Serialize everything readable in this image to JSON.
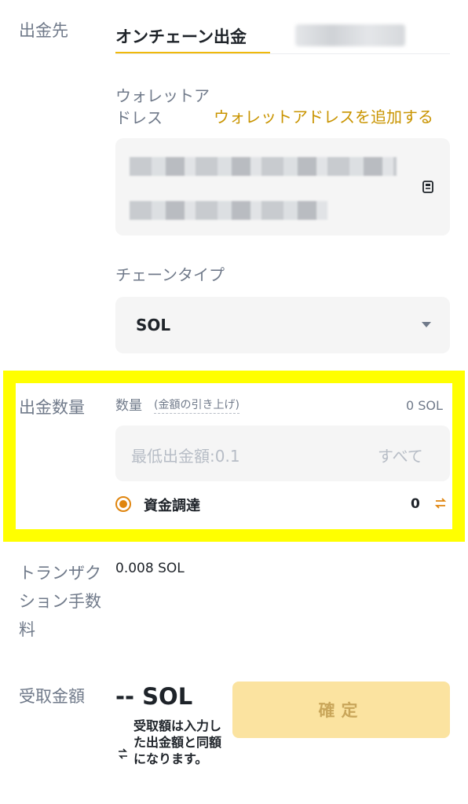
{
  "labels": {
    "destination": "出金先",
    "amount_section": "出金数量",
    "fee": "トランザクション手数料",
    "receive": "受取金額"
  },
  "tabs": {
    "onchain": "オンチェーン出金"
  },
  "wallet": {
    "label": "ウォレットアドレス",
    "add_link": "ウォレットアドレスを追加する"
  },
  "chain": {
    "label": "チェーンタイプ",
    "selected": "SOL"
  },
  "amount": {
    "label": "数量",
    "raise_link": "(金額の引き上げ)",
    "balance": "0 SOL",
    "placeholder": "最低出金額:0.1",
    "all_button": "すべて",
    "funding_label": "資金調達",
    "funding_value": "0"
  },
  "fee": {
    "value": "0.008 SOL"
  },
  "receive": {
    "value": "-- SOL",
    "note": "受取額は入力した出金額と同額になります。"
  },
  "confirm_button": "確定",
  "colors": {
    "accent": "#f0b90b",
    "link": "#c99400",
    "highlight": "#ffff00",
    "button_disabled": "#fbe3a0"
  }
}
